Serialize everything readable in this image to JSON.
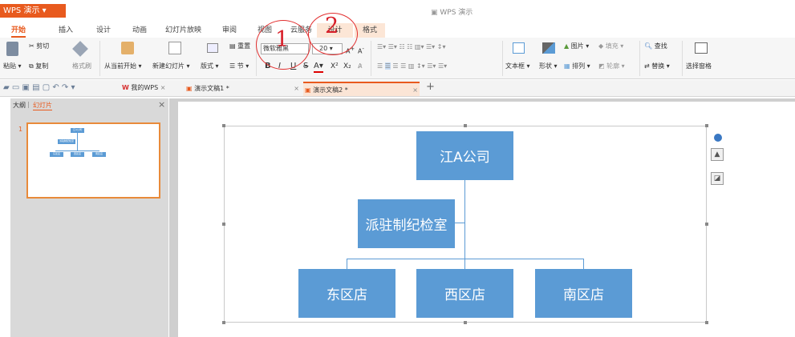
{
  "app": {
    "name": "WPS 演示",
    "window_title": "WPS 演示"
  },
  "menu_tabs": [
    "开始",
    "插入",
    "设计",
    "动画",
    "幻灯片放映",
    "审阅",
    "视图",
    "云服务",
    "设计",
    "格式"
  ],
  "ribbon": {
    "cut": "剪切",
    "paste": "粘贴",
    "copy": "复制",
    "format_painter": "格式刷",
    "from_current": "从当前开始",
    "new_slide": "新建幻灯片",
    "layout": "版式",
    "reset": "重置",
    "section": "节",
    "font_name": "微软雅黑",
    "font_size": "20",
    "bold": "B",
    "italic": "I",
    "underline": "U",
    "strike": "S",
    "font_color": "A",
    "superscript": "X²",
    "subscript": "X₂",
    "textbox": "文本框",
    "shape": "形状",
    "picture": "图片",
    "fill": "填充",
    "arrange": "排列",
    "outline": "轮廓",
    "find": "查找",
    "replace": "替换",
    "select_pane": "选择窗格"
  },
  "quick_access": {
    "my_wps": "我的WPS",
    "tabs": [
      {
        "label": "演示文稿1 *"
      },
      {
        "label": "演示文稿2 *"
      }
    ],
    "new_tab": "+"
  },
  "side_pane": {
    "tab_outline": "大纲",
    "tab_slides": "幻灯片",
    "slide_number": "1"
  },
  "org_chart": {
    "top": "江A公司",
    "assistant": "派驻制纪检室",
    "children": [
      "东区店",
      "西区店",
      "南区店"
    ]
  },
  "annotations": [
    "1",
    "2"
  ],
  "colors": {
    "accent": "#e85a1e",
    "node": "#5b9bd5",
    "annotation": "#d8202a"
  }
}
